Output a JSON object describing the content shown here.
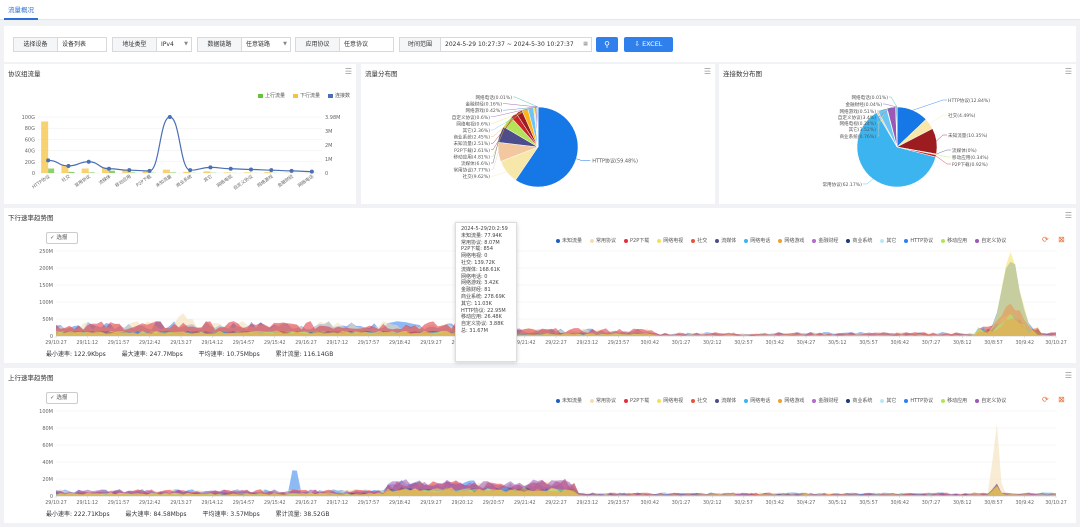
{
  "tab": {
    "label": "流量概况"
  },
  "toolbar": {
    "device_label": "选择设备",
    "device_value": "设备列表",
    "addr_label": "地址类型",
    "addr_value": "IPv4",
    "link_label": "数据链路",
    "link_value": "任意链路",
    "proto_label": "应用协议",
    "proto_value": "任意协议",
    "time_label": "时间范围",
    "time_value": "2024-5-29 10:27:37 ~ 2024-5-30 10:27:37",
    "excel_label": "EXCEL"
  },
  "proto_panel": {
    "title": "协议组流量",
    "legend": [
      {
        "label": "上行流量",
        "color": "#67c23a"
      },
      {
        "label": "下行流量",
        "color": "#f5c242"
      },
      {
        "label": "连接数",
        "color": "#4a6fb5"
      }
    ],
    "left_ticks": [
      "100G",
      "80G",
      "60G",
      "40G",
      "20G",
      "0"
    ],
    "right_ticks": [
      "3.98M",
      "3M",
      "2M",
      "1M",
      "0"
    ]
  },
  "chart_data": {
    "type": "bar",
    "categories": [
      "HTTP协议",
      "社交",
      "常用协议",
      "流媒体",
      "移动应用",
      "P2P下载",
      "未知流量",
      "商业系统",
      "其它",
      "网络电视",
      "自定义协议",
      "网络游戏",
      "金融财经",
      "网络电话"
    ],
    "series": [
      {
        "name": "上行流量",
        "type": "bar",
        "values": [
          8,
          2,
          1,
          4,
          1,
          0.5,
          1,
          0.3,
          0.5,
          0.2,
          0.2,
          0.3,
          0.1,
          0.1
        ]
      },
      {
        "name": "下行流量",
        "type": "bar",
        "values": [
          92,
          14,
          8,
          10,
          5,
          4,
          6,
          2,
          3,
          1,
          1,
          1.5,
          0.5,
          0.3
        ]
      },
      {
        "name": "连接数",
        "type": "line",
        "values": [
          0.9,
          0.5,
          0.8,
          0.3,
          0.2,
          0.15,
          3.98,
          0.2,
          0.4,
          0.3,
          0.25,
          0.2,
          0.15,
          0.1
        ]
      }
    ],
    "ylim_left": [
      0,
      100
    ],
    "ylim_right": [
      0,
      3.98
    ]
  },
  "traffic_pie": {
    "title": "流量分布图",
    "slices": [
      {
        "label": "HTTP协议(59.48%)",
        "value": 59.48,
        "color": "#1677e6"
      },
      {
        "label": "社交(9.62%)",
        "value": 9.62,
        "color": "#f7e7a8"
      },
      {
        "label": "常用协议(7.77%)",
        "value": 7.77,
        "color": "#f3c8a0"
      },
      {
        "label": "流媒体(6.6%)",
        "value": 6.6,
        "color": "#4d4d8c"
      },
      {
        "label": "移动应用(4.81%)",
        "value": 4.81,
        "color": "#b4e35a"
      },
      {
        "label": "P2P下载(2.61%)",
        "value": 2.61,
        "color": "#c9242c"
      },
      {
        "label": "未知流量(2.51%)",
        "value": 2.51,
        "color": "#9c1c20"
      },
      {
        "label": "商业系统(2.45%)",
        "value": 2.45,
        "color": "#ffb21a"
      },
      {
        "label": "其它(2.36%)",
        "value": 2.36,
        "color": "#6ac7f5"
      },
      {
        "label": "网络电视(0.6%)",
        "value": 0.6,
        "color": "#f5e05a"
      },
      {
        "label": "自定义协议(0.6%)",
        "value": 0.6,
        "color": "#9b59b6"
      },
      {
        "label": "网络游戏(0.42%)",
        "value": 0.42,
        "color": "#3c8dbc"
      },
      {
        "label": "金融财经(0.16%)",
        "value": 0.16,
        "color": "#8e44ad"
      },
      {
        "label": "网络电话(0.01%)",
        "value": 0.01,
        "color": "#1abc9c"
      }
    ]
  },
  "conn_pie": {
    "title": "连接数分布图",
    "slices": [
      {
        "label": "HTTP协议(12.84%)",
        "value": 12.84,
        "color": "#1677e6"
      },
      {
        "label": "社交(4.49%)",
        "value": 4.49,
        "color": "#f7e7a8"
      },
      {
        "label": "未知流量(10.35%)",
        "value": 10.35,
        "color": "#9c1c20"
      },
      {
        "label": "流媒体(0%)",
        "value": 0.0,
        "color": "#4d4d8c"
      },
      {
        "label": "移动应用(0.34%)",
        "value": 0.34,
        "color": "#b4e35a"
      },
      {
        "label": "P2P下载(0.92%)",
        "value": 0.92,
        "color": "#c9242c"
      },
      {
        "label": "常用协议(62.17%)",
        "value": 62.17,
        "color": "#3cb4ef"
      },
      {
        "label": "商业系统(0.76%)",
        "value": 0.76,
        "color": "#f3c8a0"
      },
      {
        "label": "其它(3.52%)",
        "value": 3.52,
        "color": "#6ac7f5"
      },
      {
        "label": "网络电视(0.24%)",
        "value": 0.24,
        "color": "#f5e05a"
      },
      {
        "label": "自定义协议(3.4%)",
        "value": 3.4,
        "color": "#9b59b6"
      },
      {
        "label": "网络游戏(0.51%)",
        "value": 0.51,
        "color": "#3c8dbc"
      },
      {
        "label": "金融财经(0.04%)",
        "value": 0.04,
        "color": "#8e44ad"
      },
      {
        "label": "网络电话(0.01%)",
        "value": 0.01,
        "color": "#1abc9c"
      }
    ]
  },
  "series_legend": [
    {
      "label": "未知流量",
      "color": "#1f5fbf"
    },
    {
      "label": "常用协议",
      "color": "#f3deb0"
    },
    {
      "label": "P2P下载",
      "color": "#e0313c"
    },
    {
      "label": "网络电视",
      "color": "#f5e05a"
    },
    {
      "label": "社交",
      "color": "#e8553a"
    },
    {
      "label": "流媒体",
      "color": "#4d4d8c"
    },
    {
      "label": "网络电话",
      "color": "#3cb4ef"
    },
    {
      "label": "网络游戏",
      "color": "#f0a030"
    },
    {
      "label": "金融财经",
      "color": "#b06ad0"
    },
    {
      "label": "商业系统",
      "color": "#1a3a7a"
    },
    {
      "label": "其它",
      "color": "#b8e8f5"
    },
    {
      "label": "HTTP协议",
      "color": "#2f80ed"
    },
    {
      "label": "移动应用",
      "color": "#b4e35a"
    },
    {
      "label": "自定义协议",
      "color": "#9b59b6"
    }
  ],
  "down_panel": {
    "title": "下行速率趋势图",
    "checkbox": "选报",
    "y_ticks": [
      "250M",
      "200M",
      "150M",
      "100M",
      "50M",
      "0"
    ],
    "stats": {
      "min": "最小速率: 122.9Kbps",
      "max": "最大速率: 247.7Mbps",
      "avg": "平均速率: 10.75Mbps",
      "total": "累计流量: 116.14GB"
    }
  },
  "up_panel": {
    "title": "上行速率趋势图",
    "checkbox": "选报",
    "y_ticks": [
      "100M",
      "80M",
      "60M",
      "40M",
      "20M",
      "0"
    ],
    "stats": {
      "min": "最小速率: 222.71Kbps",
      "max": "最大速率: 84.58Mbps",
      "avg": "平均速率: 3.57Mbps",
      "total": "累计流量: 38.52GB"
    }
  },
  "x_ticks": [
    "29/10:27",
    "29/11:12",
    "29/11:57",
    "29/12:42",
    "29/13:27",
    "29/14:12",
    "29/14:57",
    "29/15:42",
    "29/16:27",
    "29/17:12",
    "29/17:57",
    "29/18:42",
    "29/19:27",
    "29/20:12",
    "29/20:57",
    "29/21:42",
    "29/22:27",
    "29/23:12",
    "29/23:57",
    "30/0:42",
    "30/1:27",
    "30/2:12",
    "30/2:57",
    "30/3:42",
    "30/4:27",
    "30/5:12",
    "30/5:57",
    "30/6:42",
    "30/7:27",
    "30/8:12",
    "30/8:57",
    "30/9:42",
    "30/10:27"
  ],
  "tooltip": {
    "lines": [
      "2024-5-29/20:2:59",
      "未知流量: 77.94K",
      "常用协议: 8.07M",
      "P2P下载: 854",
      "网络电视: 0",
      "社交: 139.72K",
      "流媒体: 168.61K",
      "网络电话: 0",
      "网络游戏: 3.42K",
      "金融财经: 81",
      "商业系统: 278.69K",
      "其它: 11.03K",
      "HTTP协议: 22.95M",
      "移动应用: 26.48K",
      "自定义协议: 3.88K",
      "总: 31.67M"
    ]
  }
}
